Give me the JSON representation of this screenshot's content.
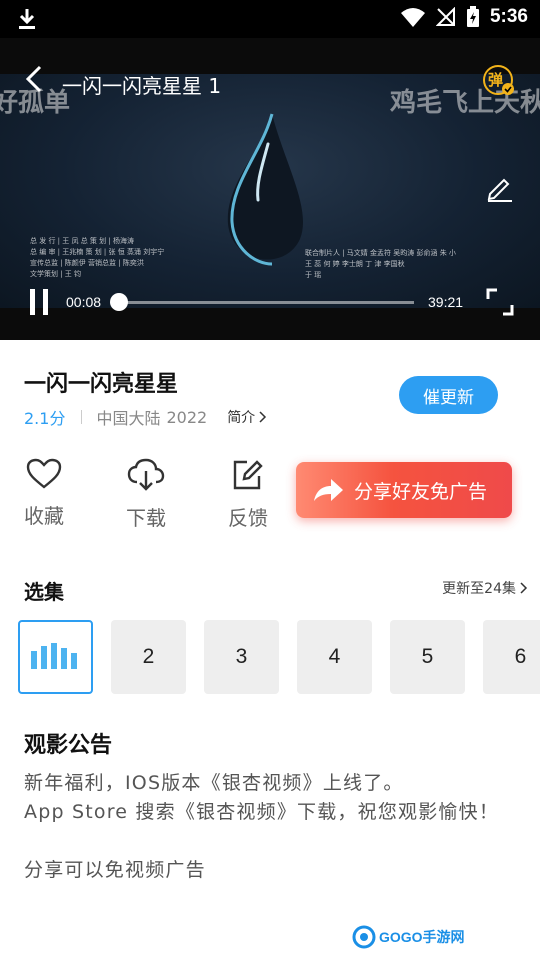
{
  "status_bar": {
    "time": "5:36"
  },
  "player": {
    "title": "一闪一闪亮星星 1",
    "danmaku_left": "好孤单",
    "danmaku_right": "鸡毛飞上天秋",
    "danmu_toggle_label": "弹",
    "current_time": "00:08",
    "total_time": "39:21",
    "progress": 0.003,
    "credits_left": [
      "总 发 行  |  王  凤      总 策 划  |  杨海涛",
      "总 编 审  |  王兆楠      策    划  |  张  恒  蒸涌  刘宇宁",
      "宣传总监  |  陈颜伊      营销总监  |  陈奕洪",
      "文学策划  |  王  钧"
    ],
    "credits_right": [
      "联合制片人  |  马文婧  金孟符  吴昀涛  彭俞涵  朱  小",
      "                 王  蕊  何  婷  李士朗  丁  津  李国秋",
      "                 于  瑶"
    ]
  },
  "show": {
    "title": "一闪一闪亮星星",
    "score": "2.1分",
    "region": "中国大陆",
    "year": "2022",
    "intro_label": "简介",
    "urge_update_label": "催更新"
  },
  "actions": {
    "favorite_label": "收藏",
    "download_label": "下载",
    "feedback_label": "反馈",
    "share_label": "分享好友免广告"
  },
  "episodes": {
    "section_title": "选集",
    "update_note": "更新至24集",
    "items": [
      "1",
      "2",
      "3",
      "4",
      "5",
      "6"
    ]
  },
  "notice": {
    "title": "观影公告",
    "body": "新年福利，IOS版本《银杏视频》上线了。\nApp Store 搜索《银杏视频》下载，祝您观影愉快！\n\n分享可以免视频广告"
  },
  "watermark": {
    "text": "GOGO手游网"
  },
  "colors": {
    "accent": "#2d9ef2",
    "share_gradient_start": "#ff8a72",
    "share_gradient_end": "#ef4a4a",
    "danmu_badge": "#f2b31a"
  }
}
